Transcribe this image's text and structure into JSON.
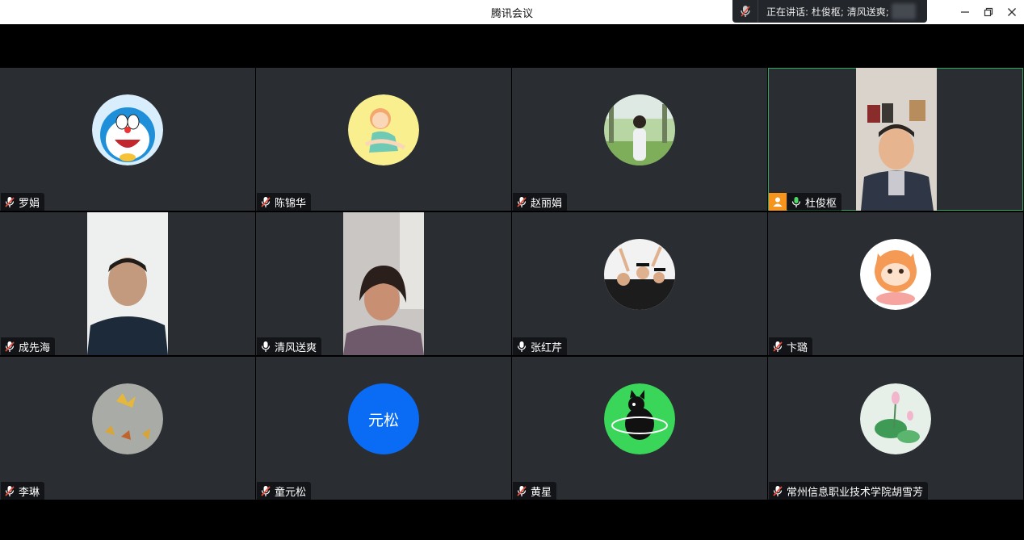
{
  "window": {
    "title": "腾讯会议",
    "speaking_text": "正在讲话: 杜俊枢; 清风送爽;",
    "controls": [
      "minimize-icon",
      "restore-icon",
      "close-icon"
    ]
  },
  "colors": {
    "tile_bg": "#2a2e33",
    "active_border": "#2aa860",
    "mic_on": "#4cd964",
    "mic_muted": "#e74c3c",
    "host_badge": "#f7941d",
    "text_avatar_bg": "#0a6cf5"
  },
  "participants": [
    {
      "name": "罗娟",
      "mic": "muted",
      "display": "avatar",
      "avatar": "doraemon"
    },
    {
      "name": "陈锦华",
      "mic": "muted",
      "display": "avatar",
      "avatar": "yoga-girl"
    },
    {
      "name": "赵丽娟",
      "mic": "muted",
      "display": "avatar",
      "avatar": "photo-woman-park"
    },
    {
      "name": "杜俊枢",
      "mic": "on",
      "display": "video",
      "host": true,
      "active_speaker": true
    },
    {
      "name": "成先海",
      "mic": "muted",
      "display": "video"
    },
    {
      "name": "清风送爽",
      "mic": "on",
      "display": "video"
    },
    {
      "name": "张红芹",
      "mic": "on",
      "display": "avatar",
      "avatar": "graduation-photo"
    },
    {
      "name": "卞璐",
      "mic": "muted",
      "display": "avatar",
      "avatar": "tiger-cartoon"
    },
    {
      "name": "李琳",
      "mic": "muted",
      "display": "avatar",
      "avatar": "autumn-leaves"
    },
    {
      "name": "童元松",
      "mic": "muted",
      "display": "text-avatar",
      "avatar_text": "元松"
    },
    {
      "name": "黄星",
      "mic": "muted",
      "display": "avatar",
      "avatar": "black-cat-green"
    },
    {
      "name": "常州信息职业技术学院胡雪芳",
      "mic": "muted",
      "display": "avatar",
      "avatar": "lotus-painting"
    }
  ]
}
